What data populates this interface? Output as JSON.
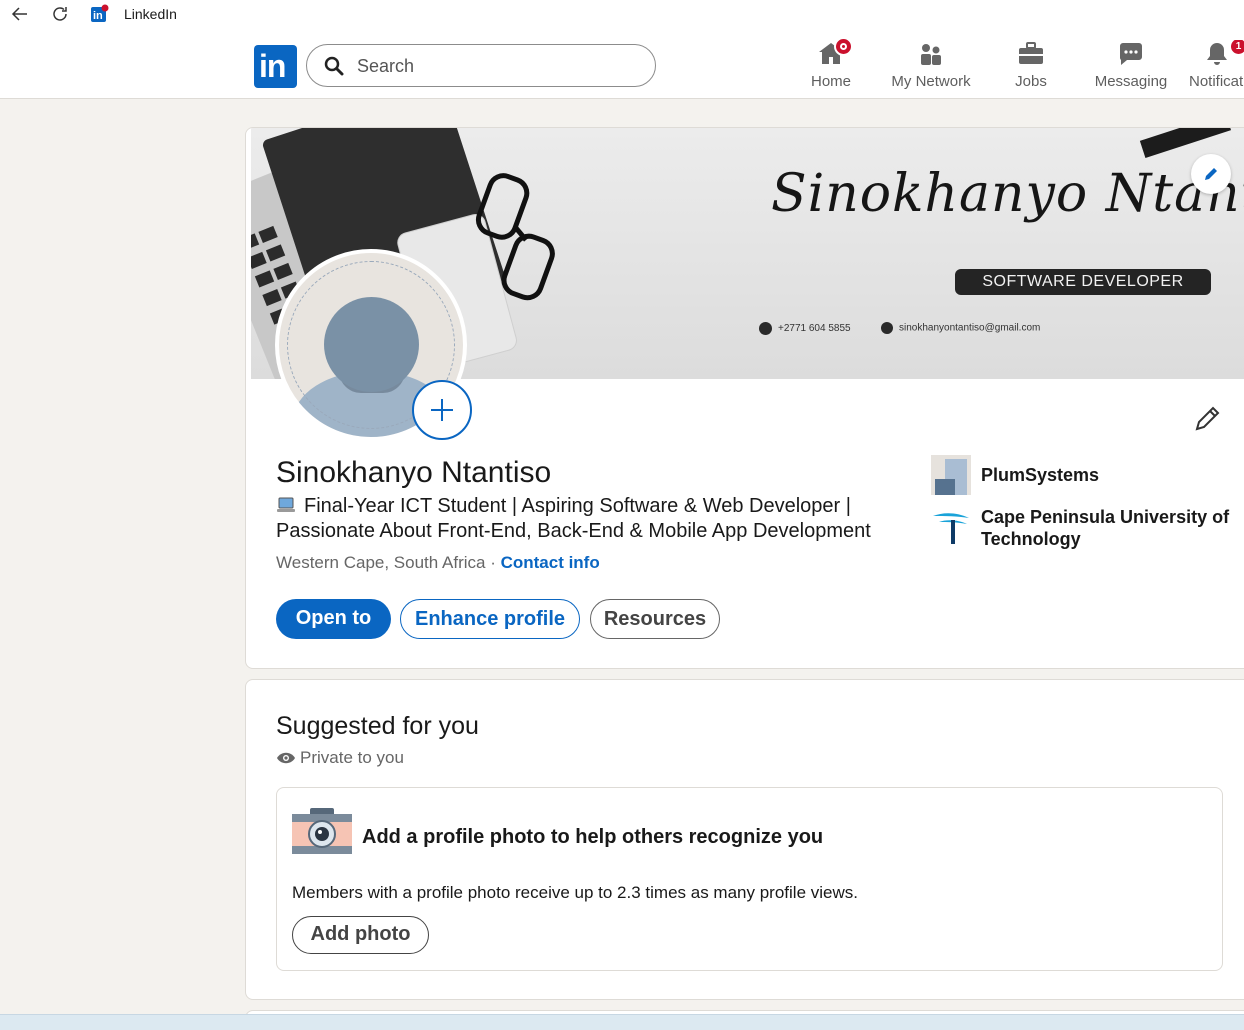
{
  "window": {
    "title": "LinkedIn"
  },
  "nav": {
    "logo_text": "in",
    "search_placeholder": "Search",
    "items": [
      {
        "label": "Home",
        "icon": "home-icon",
        "badge": ""
      },
      {
        "label": "My Network",
        "icon": "network-icon",
        "badge": ""
      },
      {
        "label": "Jobs",
        "icon": "briefcase-icon",
        "badge": ""
      },
      {
        "label": "Messaging",
        "icon": "message-icon",
        "badge": ""
      },
      {
        "label": "Notificat",
        "icon": "bell-icon",
        "badge": "1"
      }
    ]
  },
  "banner": {
    "name": "Sinokhanyo Ntantiso",
    "role": "SOFTWARE DEVELOPER",
    "phone": "+2771 604 5855",
    "email": "sinokhanyontantiso@gmail.com"
  },
  "profile": {
    "name": "Sinokhanyo Ntantiso",
    "headline": "Final-Year ICT Student | Aspiring Software & Web Developer | Passionate About Front-End, Back-End & Mobile App Development",
    "location": "Western Cape, South Africa",
    "separator": " · ",
    "contact_link": "Contact info",
    "buttons": {
      "open_to": "Open to",
      "enhance": "Enhance profile",
      "resources": "Resources"
    },
    "orgs": [
      {
        "name": "PlumSystems",
        "icon": "company-logo"
      },
      {
        "name": "Cape Peninsula University of Technology",
        "icon": "university-logo"
      }
    ]
  },
  "suggested": {
    "title": "Suggested for you",
    "privacy": "Private to you",
    "heading": "Add a profile photo to help others recognize you",
    "description": "Members with a profile photo receive up to 2.3 times as many profile views.",
    "button": "Add photo"
  },
  "colors": {
    "brand": "#0a66c2",
    "badge": "#cb112d",
    "page_bg": "#f4f2ee"
  }
}
